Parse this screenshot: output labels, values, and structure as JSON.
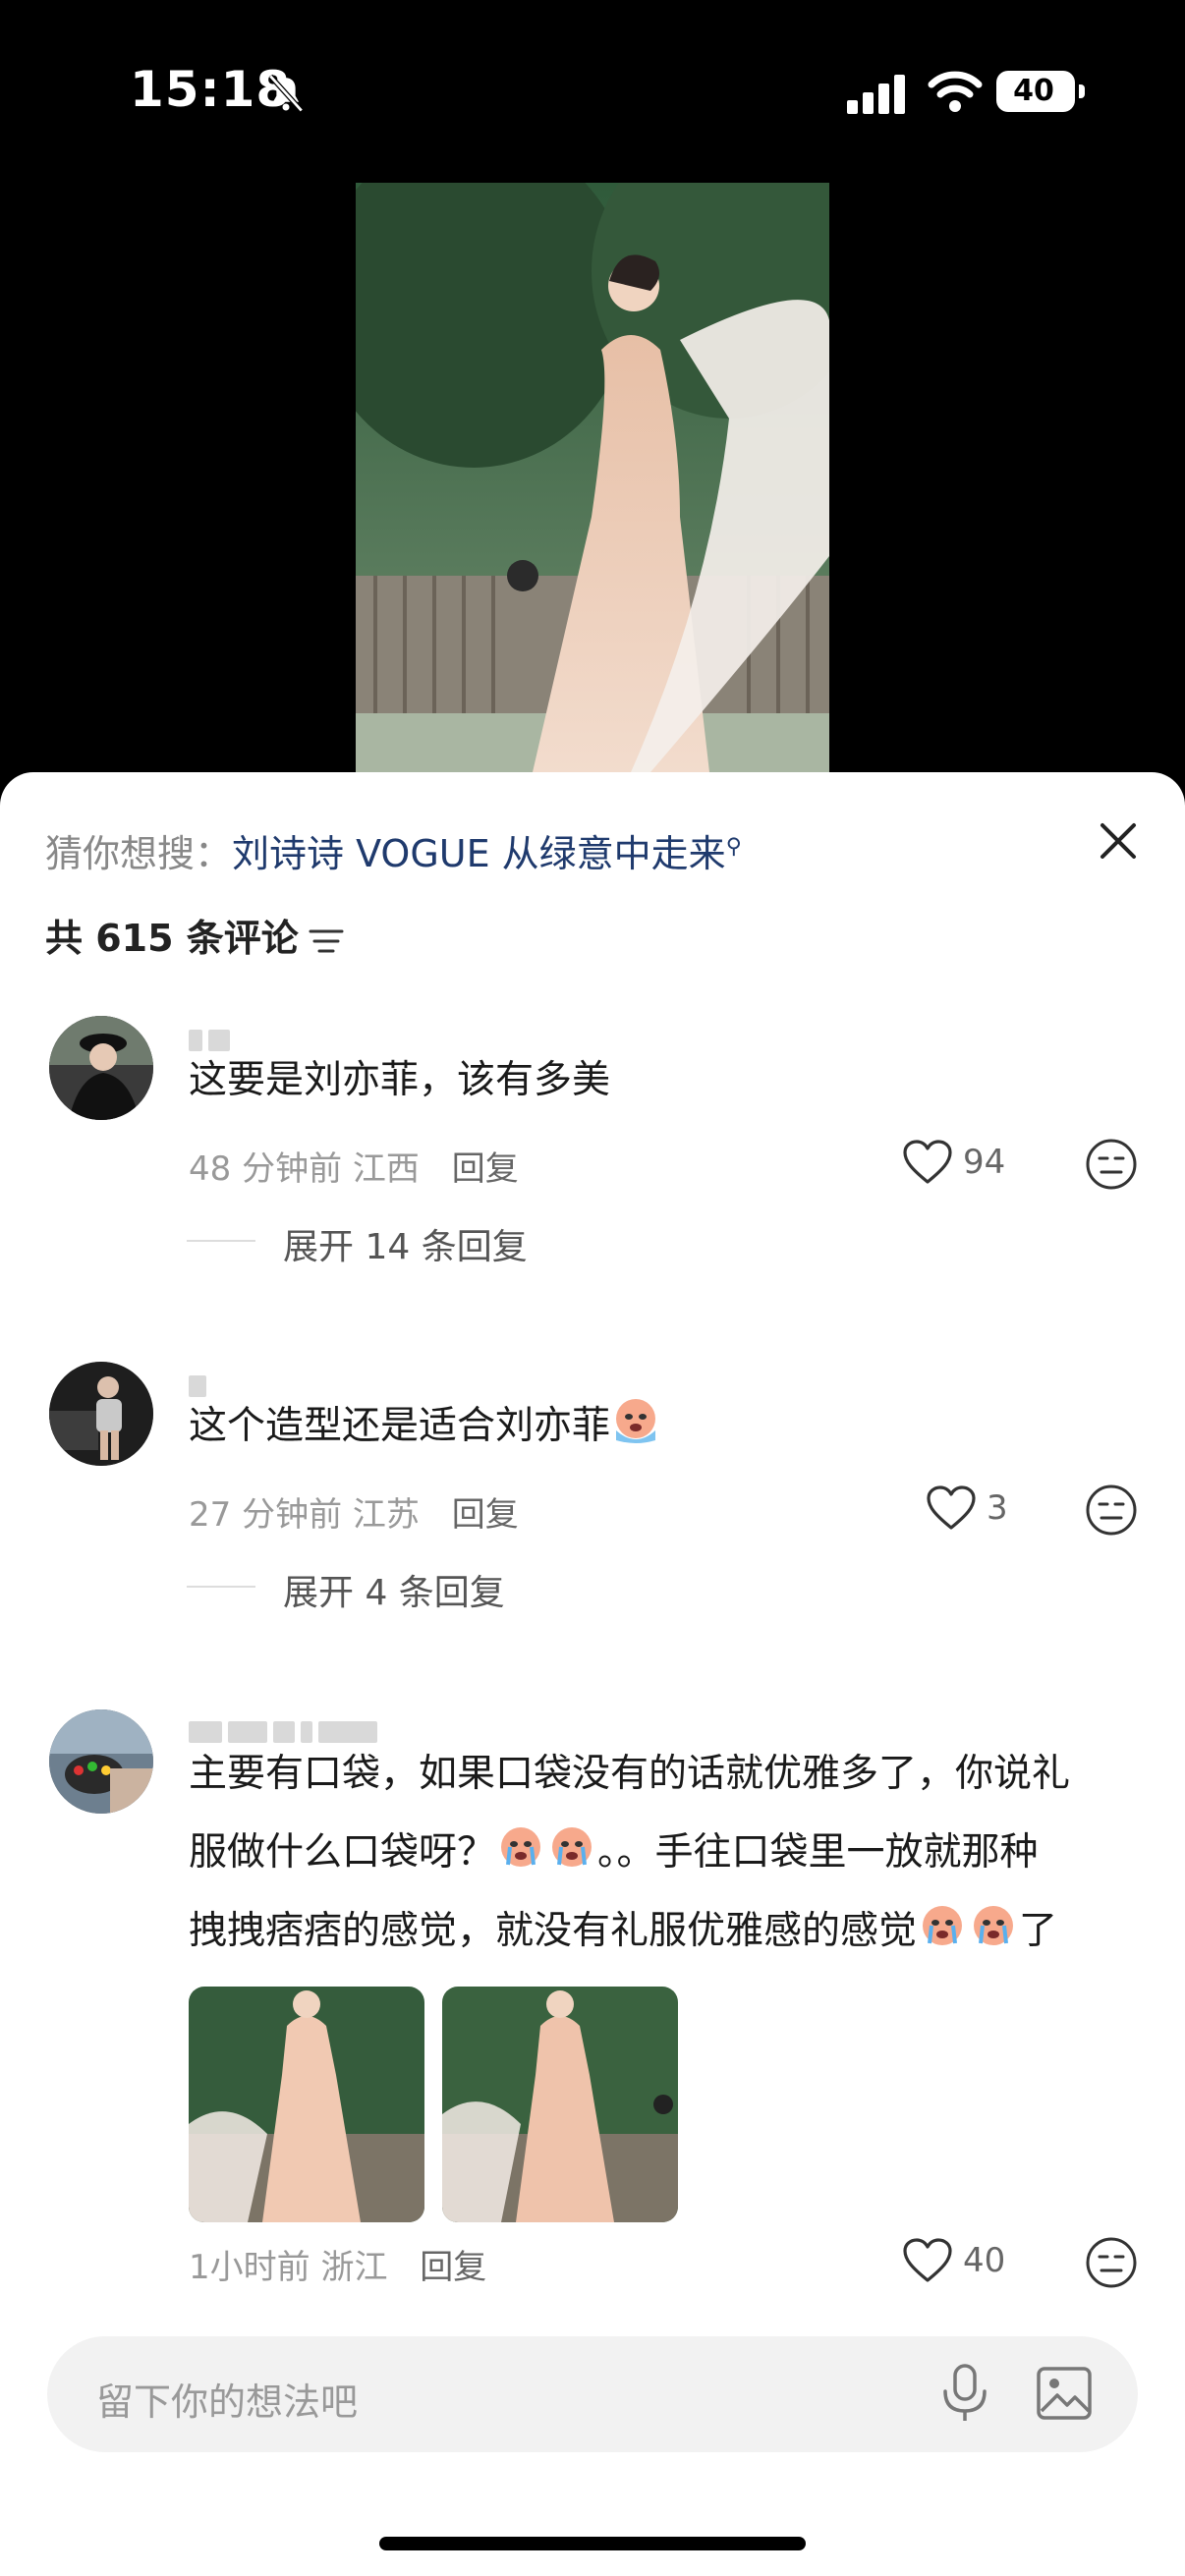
{
  "status": {
    "time": "15:18",
    "battery": "40"
  },
  "search_suggestion": {
    "prefix": "猜你想搜：",
    "term": "刘诗诗 VOGUE 从绿意中走来"
  },
  "comments_header": {
    "count_label": "共 615 条评论"
  },
  "comments": [
    {
      "text": "这要是刘亦菲，该有多美",
      "time": "48 分钟前",
      "location": "江西",
      "reply_label": "回复",
      "likes": "94",
      "expand_label": "展开 14 条回复"
    },
    {
      "text": "这个造型还是适合刘亦菲",
      "time": "27 分钟前",
      "location": "江苏",
      "reply_label": "回复",
      "likes": "3",
      "expand_label": "展开 4 条回复"
    },
    {
      "line1": "主要有口袋，如果口袋没有的话就优雅多了，你说礼",
      "line2a": "服做什么口袋呀？",
      "line2b": "。。手往口袋里一放就那种",
      "line3a": "拽拽痞痞的感觉，就没有礼服优雅感的感觉",
      "line3b": "了",
      "time": "1小时前",
      "location": "浙江",
      "reply_label": "回复",
      "likes": "40"
    }
  ],
  "input": {
    "placeholder": "留下你的想法吧"
  },
  "icons": {
    "mute": "bell-slash-icon",
    "close": "close-icon",
    "sort": "filter-icon",
    "like": "heart-icon",
    "dislike": "meh-face-icon",
    "mic": "microphone-icon",
    "image": "image-icon"
  }
}
